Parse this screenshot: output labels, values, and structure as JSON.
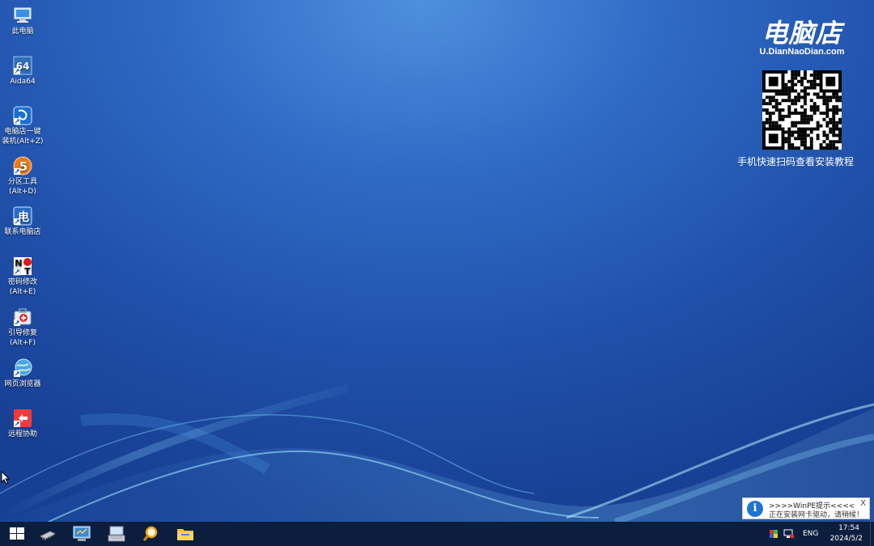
{
  "desktop_icons": [
    {
      "label_line1": "此电脑",
      "label_line2": "",
      "icon": "computer-icon"
    },
    {
      "label_line1": "Aida64",
      "label_line2": "",
      "icon": "aida64-icon"
    },
    {
      "label_line1": "电脑店一键",
      "label_line2": "装机(Alt+Z)",
      "icon": "installer-icon"
    },
    {
      "label_line1": "分区工具",
      "label_line2": "(Alt+D)",
      "icon": "partition-icon"
    },
    {
      "label_line1": "联系电脑店",
      "label_line2": "",
      "icon": "contact-icon"
    },
    {
      "label_line1": "密码修改",
      "label_line2": "(Alt+E)",
      "icon": "password-icon"
    },
    {
      "label_line1": "引导修复",
      "label_line2": "(Alt+F)",
      "icon": "boot-repair-icon"
    },
    {
      "label_line1": "网页浏览器",
      "label_line2": "",
      "icon": "browser-icon"
    },
    {
      "label_line1": "远程协助",
      "label_line2": "",
      "icon": "remote-assist-icon"
    }
  ],
  "brand": {
    "name": "电脑店",
    "url": "U.DianNaoDian.com",
    "caption": "手机快速扫码查看安装教程"
  },
  "notification": {
    "title": ">>>>WinPE提示<<<<",
    "message": "正在安装网卡驱动，请稍候！",
    "close": "X"
  },
  "taskbar": {
    "items": [
      "start-icon",
      "memory-chip-icon",
      "system-monitor-icon",
      "keyboard-icon",
      "search-tool-icon",
      "file-explorer-icon"
    ],
    "language": "ENG",
    "time": "17:54",
    "date": "2024/5/2"
  },
  "colors": {
    "desktop_top": "#4f8fde",
    "desktop_bottom": "#173f93",
    "taskbar": "#0c1e3d",
    "notify_icon": "#1f74d1"
  }
}
